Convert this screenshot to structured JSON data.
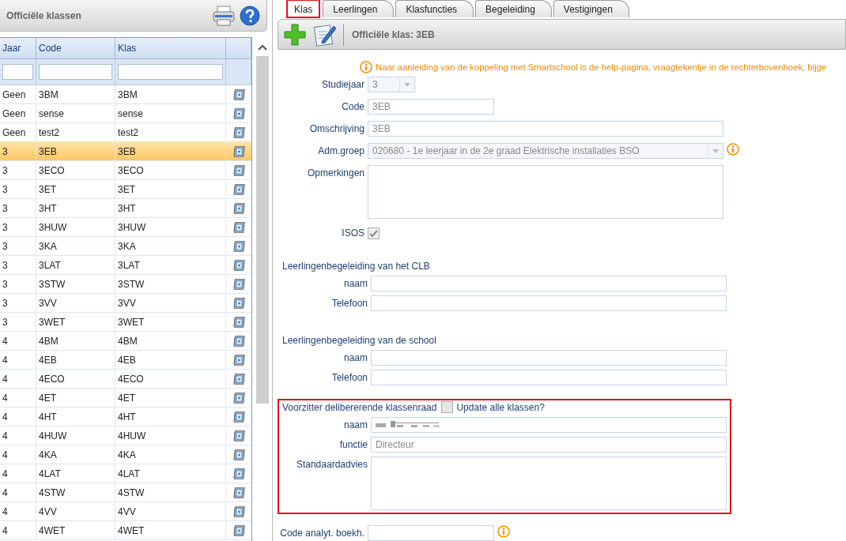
{
  "left_panel": {
    "title": "Officiële klassen"
  },
  "table": {
    "columns": [
      "Jaar",
      "Code",
      "Klas"
    ],
    "rows": [
      {
        "jaar": "Geen",
        "code": "3BM",
        "klas": "3BM",
        "selected": false
      },
      {
        "jaar": "Geen",
        "code": "sense",
        "klas": "sense",
        "selected": false
      },
      {
        "jaar": "Geen",
        "code": "test2",
        "klas": "test2",
        "selected": false
      },
      {
        "jaar": "3",
        "code": "3EB",
        "klas": "3EB",
        "selected": true
      },
      {
        "jaar": "3",
        "code": "3ECO",
        "klas": "3ECO",
        "selected": false
      },
      {
        "jaar": "3",
        "code": "3ET",
        "klas": "3ET",
        "selected": false
      },
      {
        "jaar": "3",
        "code": "3HT",
        "klas": "3HT",
        "selected": false
      },
      {
        "jaar": "3",
        "code": "3HUW",
        "klas": "3HUW",
        "selected": false
      },
      {
        "jaar": "3",
        "code": "3KA",
        "klas": "3KA",
        "selected": false
      },
      {
        "jaar": "3",
        "code": "3LAT",
        "klas": "3LAT",
        "selected": false
      },
      {
        "jaar": "3",
        "code": "3STW",
        "klas": "3STW",
        "selected": false
      },
      {
        "jaar": "3",
        "code": "3VV",
        "klas": "3VV",
        "selected": false
      },
      {
        "jaar": "3",
        "code": "3WET",
        "klas": "3WET",
        "selected": false
      },
      {
        "jaar": "4",
        "code": "4BM",
        "klas": "4BM",
        "selected": false
      },
      {
        "jaar": "4",
        "code": "4EB",
        "klas": "4EB",
        "selected": false
      },
      {
        "jaar": "4",
        "code": "4ECO",
        "klas": "4ECO",
        "selected": false
      },
      {
        "jaar": "4",
        "code": "4ET",
        "klas": "4ET",
        "selected": false
      },
      {
        "jaar": "4",
        "code": "4HT",
        "klas": "4HT",
        "selected": false
      },
      {
        "jaar": "4",
        "code": "4HUW",
        "klas": "4HUW",
        "selected": false
      },
      {
        "jaar": "4",
        "code": "4KA",
        "klas": "4KA",
        "selected": false
      },
      {
        "jaar": "4",
        "code": "4LAT",
        "klas": "4LAT",
        "selected": false
      },
      {
        "jaar": "4",
        "code": "4STW",
        "klas": "4STW",
        "selected": false
      },
      {
        "jaar": "4",
        "code": "4VV",
        "klas": "4VV",
        "selected": false
      },
      {
        "jaar": "4",
        "code": "4WET",
        "klas": "4WET",
        "selected": false
      }
    ]
  },
  "tabs": [
    {
      "label": "Klas",
      "selected": true,
      "highlighted": true
    },
    {
      "label": "Leerlingen",
      "selected": false,
      "highlighted": false
    },
    {
      "label": "Klasfuncties",
      "selected": false,
      "highlighted": false
    },
    {
      "label": "Begeleiding",
      "selected": false,
      "highlighted": false
    },
    {
      "label": "Vestigingen",
      "selected": false,
      "highlighted": false
    }
  ],
  "toolbar": {
    "title": "Officiële klas: 3EB"
  },
  "notice": "Naar aanleiding van de koppeling met Smartschool is de help-pagina, vraagtekentje in de rechterbovenhoek, bijge",
  "klas_fields": [
    {
      "kind": "select",
      "label": "Studiejaar",
      "value": "3"
    },
    {
      "kind": "text",
      "label": "Code",
      "value": "3EB"
    },
    {
      "kind": "text",
      "label": "Omschrijving",
      "value": "3EB"
    },
    {
      "kind": "select",
      "label": "Adm.groep",
      "value": "020680 - 1e leerjaar in de 2e graad Elektrische installaties BSO",
      "info": true
    },
    {
      "kind": "textarea",
      "label": "Opmerkingen"
    },
    {
      "kind": "checkbox",
      "label": "ISOS",
      "checked": true
    }
  ],
  "sections": [
    {
      "heading": "Leerlingenbegeleiding van het CLB",
      "highlighted": false,
      "fields": [
        {
          "kind": "text",
          "label": "naam"
        },
        {
          "kind": "text",
          "label": "Telefoon"
        }
      ]
    },
    {
      "heading": "Leerlingenbegeleiding van de school",
      "highlighted": false,
      "fields": [
        {
          "kind": "text",
          "label": "naam"
        },
        {
          "kind": "text",
          "label": "Telefoon"
        }
      ]
    },
    {
      "heading": "Voorzitter delibererende klassenraad",
      "highlighted": true,
      "update_all": {
        "label": "Update alle klassen?",
        "checked": false
      },
      "fields": [
        {
          "kind": "text",
          "label": "naam",
          "redacted": true
        },
        {
          "kind": "text",
          "label": "functie",
          "value": "Directeur"
        },
        {
          "kind": "textarea",
          "label": "Standaardadvies"
        }
      ]
    }
  ],
  "analytic_code": {
    "label": "Code analyt. boekh.",
    "info": true
  }
}
